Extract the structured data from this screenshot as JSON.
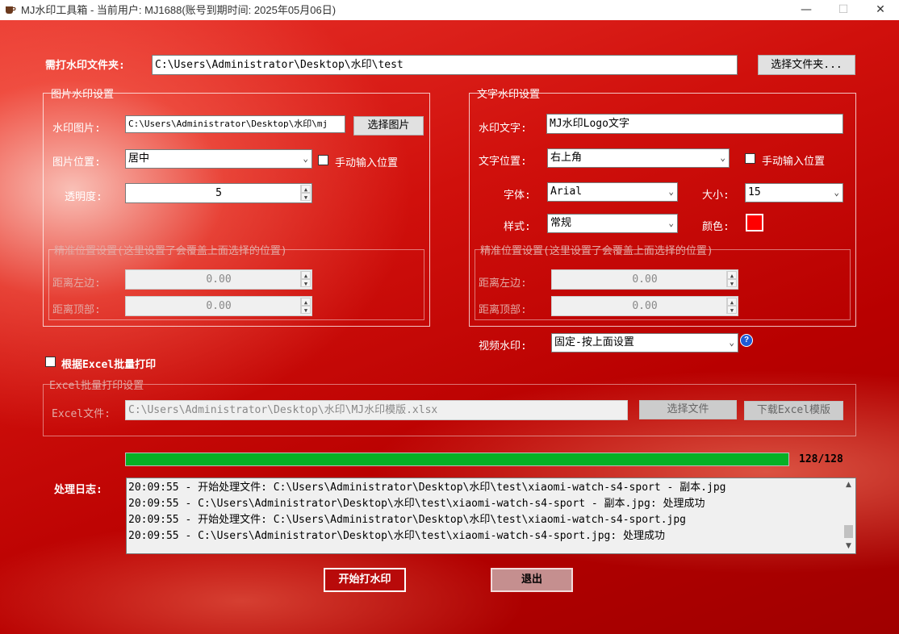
{
  "window": {
    "title": "MJ水印工具箱 - 当前用户: MJ1688(账号到期时间: 2025年05月06日)",
    "minimize": "—",
    "maximize": "☐",
    "close": "✕"
  },
  "folder": {
    "label": "需打水印文件夹:",
    "value": "C:\\Users\\Administrator\\Desktop\\水印\\test",
    "button": "选择文件夹..."
  },
  "image_wm": {
    "legend": "图片水印设置",
    "image_label": "水印图片:",
    "image_value": "C:\\Users\\Administrator\\Desktop\\水印\\mj",
    "image_button": "选择图片",
    "position_label": "图片位置:",
    "position_value": "居中",
    "manual_label": "手动输入位置",
    "manual_checked": false,
    "opacity_label": "透明度:",
    "opacity_value": "5",
    "precise_legend": "精准位置设置(这里设置了会覆盖上面选择的位置)",
    "left_label": "距离左边:",
    "left_value": "0.00",
    "top_label": "距离顶部:",
    "top_value": "0.00"
  },
  "text_wm": {
    "legend": "文字水印设置",
    "text_label": "水印文字:",
    "text_value": "MJ水印Logo文字",
    "position_label": "文字位置:",
    "position_value": "右上角",
    "manual_label": "手动输入位置",
    "manual_checked": false,
    "font_label": "字体:",
    "font_value": "Arial",
    "size_label": "大小:",
    "size_value": "15",
    "style_label": "样式:",
    "style_value": "常规",
    "color_label": "颜色:",
    "color_value": "#ff0000",
    "precise_legend": "精准位置设置(这里设置了会覆盖上面选择的位置)",
    "left_label": "距离左边:",
    "left_value": "0.00",
    "top_label": "距离顶部:",
    "top_value": "0.00"
  },
  "video_wm": {
    "label": "视频水印:",
    "value": "固定-按上面设置",
    "help": "?"
  },
  "excel": {
    "checkbox_label": "根据Excel批量打印",
    "checked": false,
    "legend": "Excel批量打印设置",
    "file_label": "Excel文件:",
    "file_value": "C:\\Users\\Administrator\\Desktop\\水印\\MJ水印模版.xlsx",
    "choose_button": "选择文件",
    "download_button": "下载Excel模版"
  },
  "progress": {
    "fraction": 1.0,
    "text": "128/128",
    "color": "#06b025"
  },
  "log": {
    "label": "处理日志:",
    "lines": [
      "20:09:55 - 开始处理文件: C:\\Users\\Administrator\\Desktop\\水印\\test\\xiaomi-watch-s4-sport - 副本.jpg",
      "20:09:55 - C:\\Users\\Administrator\\Desktop\\水印\\test\\xiaomi-watch-s4-sport - 副本.jpg: 处理成功",
      "20:09:55 - 开始处理文件: C:\\Users\\Administrator\\Desktop\\水印\\test\\xiaomi-watch-s4-sport.jpg",
      "20:09:55 - C:\\Users\\Administrator\\Desktop\\水印\\test\\xiaomi-watch-s4-sport.jpg: 处理成功"
    ]
  },
  "actions": {
    "start": "开始打水印",
    "exit": "退出"
  },
  "icons": {
    "app": "coffee-cup-icon",
    "help": "help-circle-icon"
  }
}
